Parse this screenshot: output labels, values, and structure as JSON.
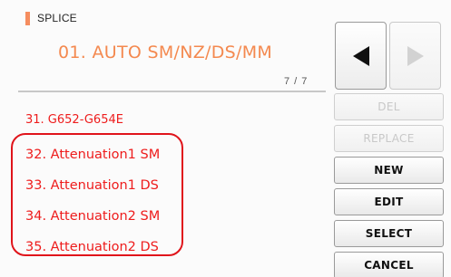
{
  "header": {
    "section_title": "SPLICE",
    "mode_name": "01. AUTO SM/NZ/DS/MM",
    "page_indicator": "7 / 7",
    "accent_color": "#f58d5f"
  },
  "list": {
    "items": [
      {
        "label": "31. G652-G654E"
      },
      {
        "label": "32. Attenuation1 SM"
      },
      {
        "label": "33. Attenuation1 DS"
      },
      {
        "label": "34. Attenuation2 SM"
      },
      {
        "label": "35. Attenuation2 DS"
      }
    ],
    "text_color": "#ee1c1c",
    "highlight_color": "#e0141b"
  },
  "nav": {
    "prev_icon": "triangle-left-icon",
    "next_icon": "triangle-right-icon",
    "next_enabled": false
  },
  "actions": {
    "del_label": "DEL",
    "replace_label": "REPLACE",
    "new_label": "NEW",
    "edit_label": "EDIT",
    "select_label": "SELECT",
    "cancel_label": "CANCEL"
  }
}
